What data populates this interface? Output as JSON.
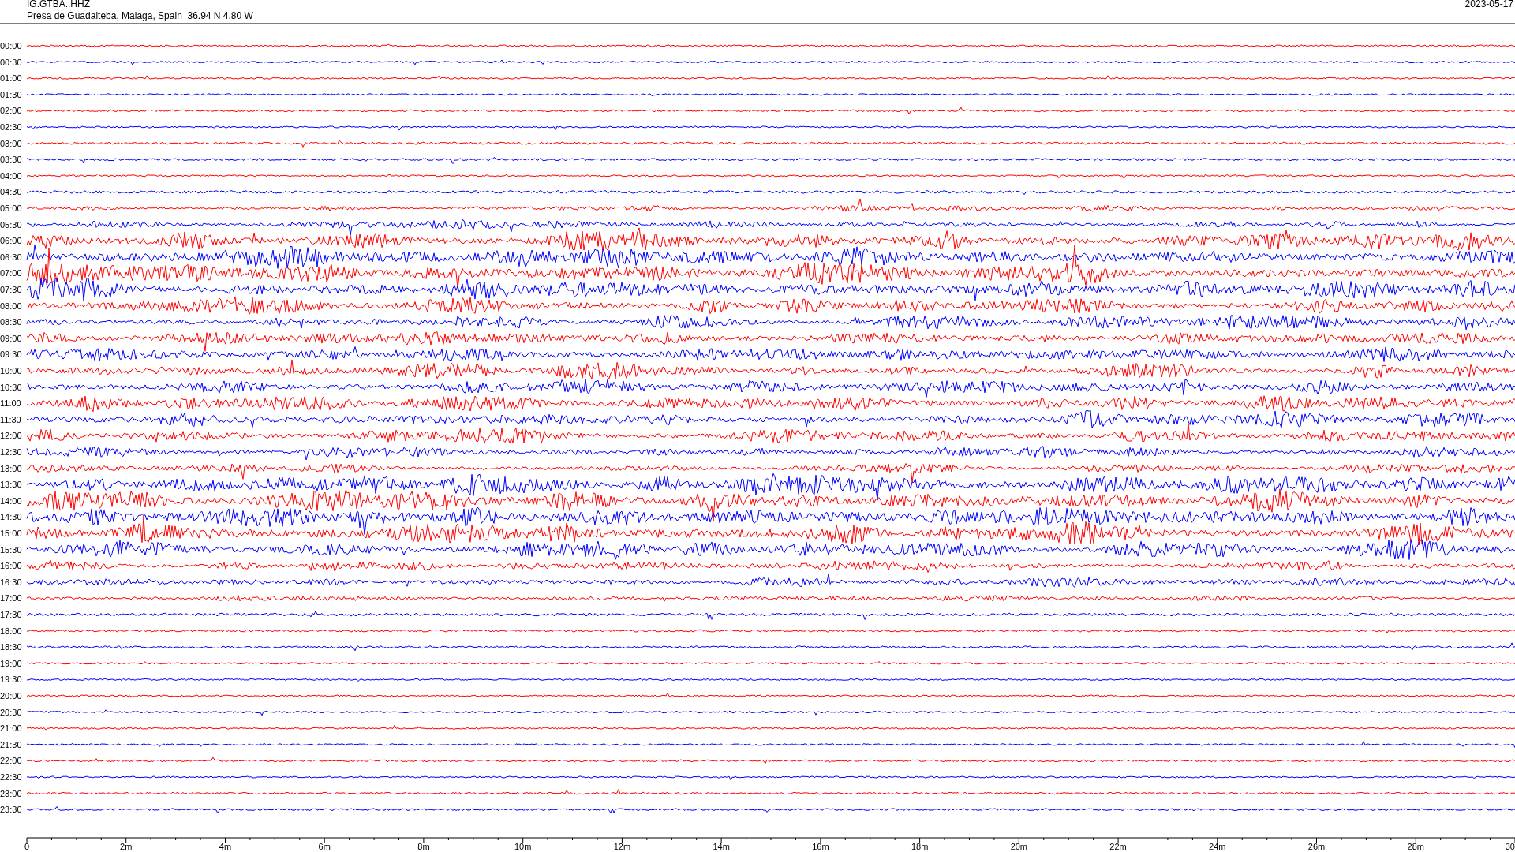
{
  "header": {
    "station": "IG.GTBA..HHZ",
    "location": "Presa de Guadalteba, Malaga, Spain  36.94 N 4.80 W",
    "date": "2023-05-17"
  },
  "traces": [
    {
      "label": "00:00",
      "color": "#ff0000"
    },
    {
      "label": "00:30",
      "color": "#0000ff"
    },
    {
      "label": "01:00",
      "color": "#ff0000"
    },
    {
      "label": "01:30",
      "color": "#0000ff"
    },
    {
      "label": "02:00",
      "color": "#ff0000"
    },
    {
      "label": "02:30",
      "color": "#0000ff"
    },
    {
      "label": "03:00",
      "color": "#ff0000"
    },
    {
      "label": "03:30",
      "color": "#0000ff"
    },
    {
      "label": "04:00",
      "color": "#ff0000"
    },
    {
      "label": "04:30",
      "color": "#0000ff"
    },
    {
      "label": "05:00",
      "color": "#ff0000"
    },
    {
      "label": "05:30",
      "color": "#0000ff"
    },
    {
      "label": "06:00",
      "color": "#ff0000"
    },
    {
      "label": "06:30",
      "color": "#0000ff"
    },
    {
      "label": "07:00",
      "color": "#ff0000"
    },
    {
      "label": "07:30",
      "color": "#0000ff"
    },
    {
      "label": "08:00",
      "color": "#ff0000"
    },
    {
      "label": "08:30",
      "color": "#0000ff"
    },
    {
      "label": "09:00",
      "color": "#ff0000"
    },
    {
      "label": "09:30",
      "color": "#0000ff"
    },
    {
      "label": "10:00",
      "color": "#ff0000"
    },
    {
      "label": "10:30",
      "color": "#0000ff"
    },
    {
      "label": "11:00",
      "color": "#ff0000"
    },
    {
      "label": "11:30",
      "color": "#0000ff"
    },
    {
      "label": "12:00",
      "color": "#ff0000"
    },
    {
      "label": "12:30",
      "color": "#0000ff"
    },
    {
      "label": "13:00",
      "color": "#ff0000"
    },
    {
      "label": "13:30",
      "color": "#0000ff"
    },
    {
      "label": "14:00",
      "color": "#ff0000"
    },
    {
      "label": "14:30",
      "color": "#0000ff"
    },
    {
      "label": "15:00",
      "color": "#ff0000"
    },
    {
      "label": "15:30",
      "color": "#0000ff"
    },
    {
      "label": "16:00",
      "color": "#ff0000"
    },
    {
      "label": "16:30",
      "color": "#0000ff"
    },
    {
      "label": "17:00",
      "color": "#ff0000"
    },
    {
      "label": "17:30",
      "color": "#0000ff"
    },
    {
      "label": "18:00",
      "color": "#ff0000"
    },
    {
      "label": "18:30",
      "color": "#0000ff"
    },
    {
      "label": "19:00",
      "color": "#ff0000"
    },
    {
      "label": "19:30",
      "color": "#0000ff"
    },
    {
      "label": "20:00",
      "color": "#ff0000"
    },
    {
      "label": "20:30",
      "color": "#0000ff"
    },
    {
      "label": "21:00",
      "color": "#ff0000"
    },
    {
      "label": "21:30",
      "color": "#0000ff"
    },
    {
      "label": "22:00",
      "color": "#ff0000"
    },
    {
      "label": "22:30",
      "color": "#0000ff"
    },
    {
      "label": "23:00",
      "color": "#ff0000"
    },
    {
      "label": "23:30",
      "color": "#0000ff"
    }
  ],
  "time_axis": {
    "labels": [
      "0",
      "2m",
      "4m",
      "6m",
      "8m",
      "10m",
      "12m",
      "14m",
      "16m",
      "18m",
      "20m",
      "22m",
      "24m",
      "26m",
      "28m",
      "30"
    ]
  }
}
